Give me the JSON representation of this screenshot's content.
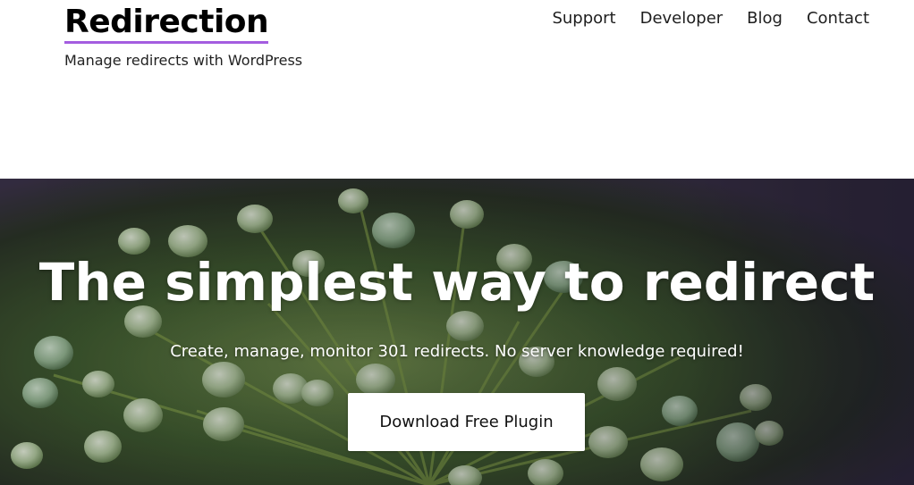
{
  "header": {
    "site_title": "Redirection",
    "tagline": "Manage redirects with WordPress",
    "nav": [
      {
        "label": "Support"
      },
      {
        "label": "Developer"
      },
      {
        "label": "Blog"
      },
      {
        "label": "Contact"
      }
    ],
    "accent_color": "#a45de0"
  },
  "hero": {
    "title": "The simplest way to redirect",
    "subtitle": "Create, manage, monitor 301 redirects. No server knowledge required!",
    "cta_label": "Download Free Plugin",
    "background_image": "allium seed-head flowers photo"
  }
}
